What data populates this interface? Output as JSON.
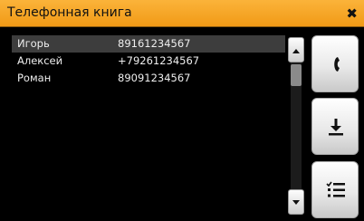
{
  "window": {
    "title": "Телефонная книга",
    "close_glyph": "✖"
  },
  "contacts": [
    {
      "name": "Игорь",
      "phone": "89161234567",
      "selected": true
    },
    {
      "name": "Алексей",
      "phone": "+79261234567",
      "selected": false
    },
    {
      "name": "Роман",
      "phone": "89091234567",
      "selected": false
    }
  ],
  "side_buttons": [
    {
      "icon": "phone-handset-icon",
      "action": "call"
    },
    {
      "icon": "download-icon",
      "action": "save"
    },
    {
      "icon": "checklist-icon",
      "action": "list"
    }
  ],
  "colors": {
    "titlebar": "#f5a623",
    "background": "#000000",
    "selected_row": "#3d3d3d",
    "text": "#eeeeee"
  }
}
